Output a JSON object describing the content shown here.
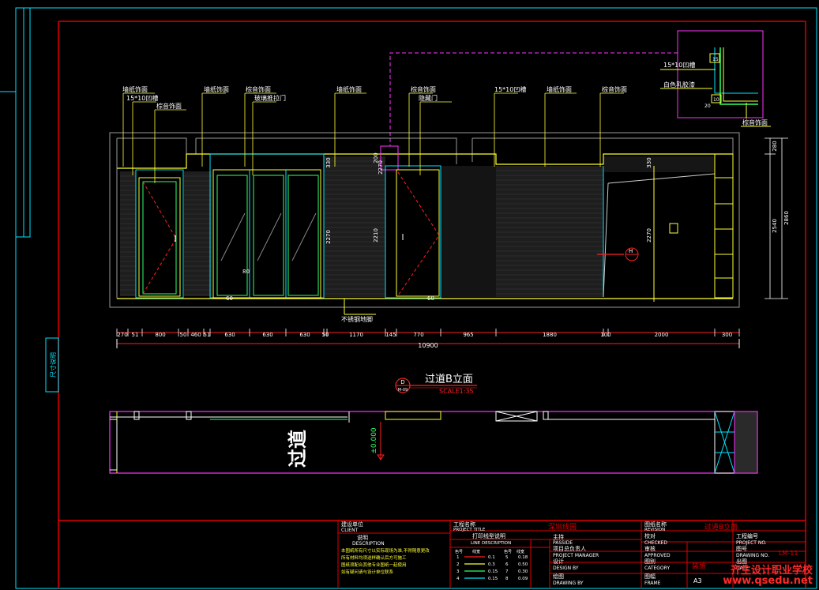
{
  "colors": {
    "bg": "#000000",
    "border": "#e00000",
    "cyan": "#00e5ff",
    "yellow": "#ffff33",
    "magenta": "#ff33ff",
    "red": "#ff2020",
    "green": "#33ff66",
    "white": "#ffffff",
    "gray": "#bfbfbf"
  },
  "labels": [
    "墙纸饰面",
    "15*10凹槽",
    "棕音饰面",
    "墙纸饰面",
    "棕音饰面",
    "玻璃推拉门",
    "墙纸饰面",
    "棕音饰面",
    "隐藏门",
    "15*10凹槽",
    "墙纸饰面",
    "棕音饰面"
  ],
  "detail": {
    "groove": "15*10凹槽",
    "paint": "白色乳胶漆",
    "panel": "棕音饰面",
    "n15": "15",
    "n10": "10",
    "n20": "20"
  },
  "vertical_dims": [
    "330",
    "2270",
    "200",
    "2270",
    "2210",
    "330",
    "2270"
  ],
  "right_dims": {
    "top": "280",
    "mid": "2540",
    "total": "2860"
  },
  "door_mark": "H",
  "small_dims": [
    "80",
    "60",
    "60"
  ],
  "floor_note": "不锈钢地脚",
  "dimensions": [
    "270",
    "51",
    "800",
    "50",
    "460",
    "51",
    "630",
    "630",
    "630",
    "50",
    "1170",
    "145",
    "770",
    "965",
    "1880",
    "100",
    "2000",
    "300"
  ],
  "total_dim": "10900",
  "elevation": {
    "symbol_top": "D",
    "symbol_bottom": "M-09",
    "title": "过道B立面",
    "scale": "SCALE1:35"
  },
  "plan": {
    "corridor": "过道",
    "level": "±0.000"
  },
  "left_strip": "尺寸说明",
  "title_block": {
    "client_cn": "建设单位",
    "client_en": "CLIENT",
    "desc_cn": "说明",
    "desc_en": "DESCRIPTION",
    "desc_text": [
      "本图纸所有尺寸以实际现场为准,不得随意更改",
      "所有材料均须送样确认后方可施工",
      "图纸须配合其他专业图纸一起使用",
      "如有疑问请与设计单位联系"
    ],
    "project_cn": "工程名称",
    "project_en": "PROJECT TITLE",
    "project_name": "深圳线园",
    "lines_cn": "打印线型说明",
    "lines_en": "LINE DESCRIPTION",
    "line_header": [
      "色号",
      "线宽",
      "色号",
      "线宽"
    ],
    "line_rows": [
      [
        "1",
        "0.1",
        "5",
        "0.18"
      ],
      [
        "2",
        "0.3",
        "6",
        "0.50"
      ],
      [
        "3",
        "0.15",
        "7",
        "0.30"
      ],
      [
        "4",
        "0.15",
        "8",
        "0.09"
      ]
    ],
    "manager_cn": "项目总负责人",
    "manager_en": "PROJECT MANAGER",
    "pm_cn": "主持",
    "pm_en": "PASSIDE",
    "design_cn": "设计",
    "design_en": "DESIGN BY",
    "draw_cn": "绘图",
    "draw_en": "DRAWING BY",
    "drawing_title_cn": "图纸名称",
    "drawing_title_en": "REVISION",
    "drawing_title": "过道B立面",
    "check_cn": "校对",
    "check_en": "CHECKED",
    "approve_cn": "审核",
    "approve_en": "APPROVED",
    "category_cn": "图别",
    "category_en": "CATEGORY",
    "category": "装施",
    "frame_cn": "图幅",
    "frame_en": "FRAME",
    "frame": "A3",
    "project_no_cn": "工程编号",
    "project_no_en": "PROJECT NO.",
    "drawing_no_cn": "图号",
    "drawing_no_en": "DRAWING NO.",
    "drawing_no": "LM-11",
    "date_cn": "出图",
    "date_en": "DATE"
  },
  "watermark": {
    "line1": "齐生设计职业学校",
    "line2": "www.qsedu.net"
  }
}
